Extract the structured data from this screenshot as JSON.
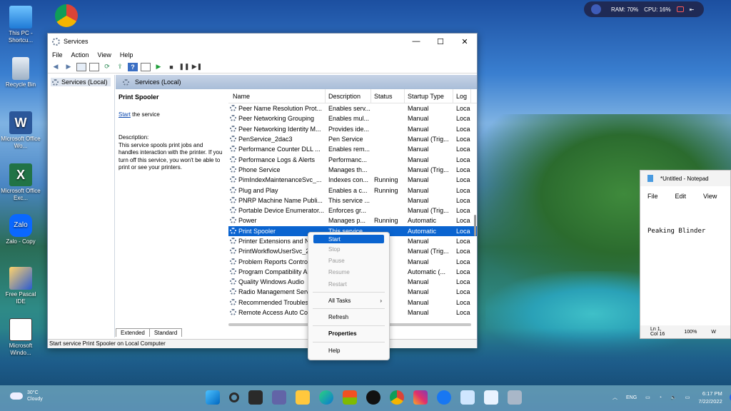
{
  "desktop_icons": [
    {
      "label": "This PC - Shortcu..."
    },
    {
      "label": "Recycle Bin"
    },
    {
      "label": "Microsoft Office Wo..."
    },
    {
      "label": "Microsoft Office Exc..."
    },
    {
      "label": "Zalo - Copy"
    },
    {
      "label": "Free Pascal IDE"
    },
    {
      "label": "Microsoft Windo..."
    }
  ],
  "widget": {
    "ram": "RAM: 70%",
    "cpu": "CPU: 16%"
  },
  "services_window": {
    "title": "Services",
    "controls": {
      "minimize": "—",
      "maximize": "☐",
      "close": "✕"
    },
    "menu": [
      "File",
      "Action",
      "View",
      "Help"
    ],
    "tree_item": "Services (Local)",
    "panel_header": "Services (Local)",
    "selected_service": {
      "name": "Print Spooler",
      "start_link": "Start",
      "start_suffix": " the service",
      "description_label": "Description:",
      "description": "This service spools print jobs and handles interaction with the printer. If you turn off this service, you won't be able to print or see your printers."
    },
    "columns": {
      "name": "Name",
      "description": "Description",
      "status": "Status",
      "startup": "Startup Type",
      "log": "Log"
    },
    "rows": [
      {
        "name": "Peer Name Resolution Prot...",
        "desc": "Enables serv...",
        "status": "",
        "startup": "Manual",
        "log": "Loca"
      },
      {
        "name": "Peer Networking Grouping",
        "desc": "Enables mul...",
        "status": "",
        "startup": "Manual",
        "log": "Loca"
      },
      {
        "name": "Peer Networking Identity M...",
        "desc": "Provides ide...",
        "status": "",
        "startup": "Manual",
        "log": "Loca"
      },
      {
        "name": "PenService_2dac3",
        "desc": "Pen Service",
        "status": "",
        "startup": "Manual (Trig...",
        "log": "Loca"
      },
      {
        "name": "Performance Counter DLL ...",
        "desc": "Enables rem...",
        "status": "",
        "startup": "Manual",
        "log": "Loca"
      },
      {
        "name": "Performance Logs & Alerts",
        "desc": "Performanc...",
        "status": "",
        "startup": "Manual",
        "log": "Loca"
      },
      {
        "name": "Phone Service",
        "desc": "Manages th...",
        "status": "",
        "startup": "Manual (Trig...",
        "log": "Loca"
      },
      {
        "name": "PimIndexMaintenanceSvc_...",
        "desc": "Indexes con...",
        "status": "Running",
        "startup": "Manual",
        "log": "Loca"
      },
      {
        "name": "Plug and Play",
        "desc": "Enables a c...",
        "status": "Running",
        "startup": "Manual",
        "log": "Loca"
      },
      {
        "name": "PNRP Machine Name Publi...",
        "desc": "This service ...",
        "status": "",
        "startup": "Manual",
        "log": "Loca"
      },
      {
        "name": "Portable Device Enumerator...",
        "desc": "Enforces gr...",
        "status": "",
        "startup": "Manual (Trig...",
        "log": "Loca"
      },
      {
        "name": "Power",
        "desc": "Manages p...",
        "status": "Running",
        "startup": "Automatic",
        "log": "Loca"
      },
      {
        "name": "Print Spooler",
        "desc": "This service ...",
        "status": "",
        "startup": "Automatic",
        "log": "Loca"
      },
      {
        "name": "Printer Extensions and N",
        "desc": "",
        "status": "",
        "startup": "Manual",
        "log": "Loca"
      },
      {
        "name": "PrintWorkflowUserSvc_2",
        "desc": "",
        "status": "",
        "startup": "Manual (Trig...",
        "log": "Loca"
      },
      {
        "name": "Problem Reports Contro",
        "desc": "",
        "status": "",
        "startup": "Manual",
        "log": "Loca"
      },
      {
        "name": "Program Compatibility A",
        "desc": "",
        "status": "ng",
        "startup": "Automatic (...",
        "log": "Loca"
      },
      {
        "name": "Quality Windows Audio",
        "desc": "",
        "status": "",
        "startup": "Manual",
        "log": "Loca"
      },
      {
        "name": "Radio Management Serv",
        "desc": "",
        "status": "ng",
        "startup": "Manual",
        "log": "Loca"
      },
      {
        "name": "Recommended Troubles",
        "desc": "",
        "status": "",
        "startup": "Manual",
        "log": "Loca"
      },
      {
        "name": "Remote Access Auto Co",
        "desc": "",
        "status": "",
        "startup": "Manual",
        "log": "Loca"
      }
    ],
    "tabs": [
      "Extended",
      "Standard"
    ],
    "status_bar": "Start service Print Spooler on Local Computer"
  },
  "context_menu": {
    "items": [
      "Start",
      "Stop",
      "Pause",
      "Resume",
      "Restart"
    ],
    "all_tasks": "All Tasks",
    "refresh": "Refresh",
    "properties": "Properties",
    "help": "Help"
  },
  "notepad": {
    "title": "*Untitled - Notepad",
    "menu": [
      "File",
      "Edit",
      "View"
    ],
    "content": "Peaking Blinder",
    "status": {
      "position": "Ln 1, Col 16",
      "zoom": "100%",
      "extra": "W"
    }
  },
  "taskbar": {
    "weather_temp": "30°C",
    "weather_desc": "Cloudy",
    "lang": "ENG",
    "time": "6:17 PM",
    "date": "7/22/2022",
    "notification_count": "1"
  }
}
